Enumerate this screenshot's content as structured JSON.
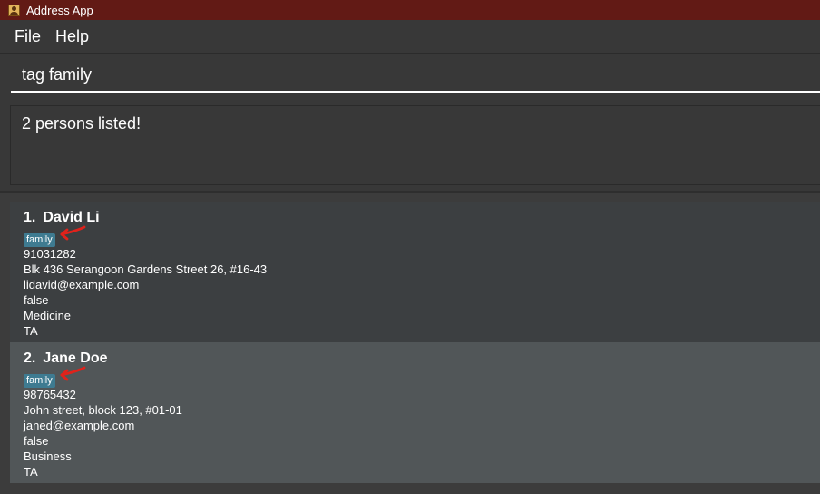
{
  "window": {
    "title": "Address App",
    "icon": "address-book-icon"
  },
  "menu": {
    "items": [
      "File",
      "Help"
    ]
  },
  "command": {
    "value": "tag family"
  },
  "result": {
    "message": "2 persons listed!"
  },
  "annotation": {
    "icon": "red-arrow-icon",
    "color": "#e0221b"
  },
  "persons": [
    {
      "index": "1.",
      "name": "David Li",
      "tag": "family",
      "phone": "91031282",
      "address": "Blk 436 Serangoon Gardens Street 26, #16-43",
      "email": "lidavid@example.com",
      "flag": "false",
      "faculty": "Medicine",
      "role": "TA"
    },
    {
      "index": "2.",
      "name": "Jane Doe",
      "tag": "family",
      "phone": "98765432",
      "address": "John street, block 123, #01-01",
      "email": "janed@example.com",
      "flag": "false",
      "faculty": "Business",
      "role": "TA"
    }
  ],
  "colors": {
    "titlebar": "#621a15",
    "background": "#3c3c3c",
    "card_odd": "#3c3f41",
    "card_even": "#515658",
    "tag": "#3e7b91"
  }
}
